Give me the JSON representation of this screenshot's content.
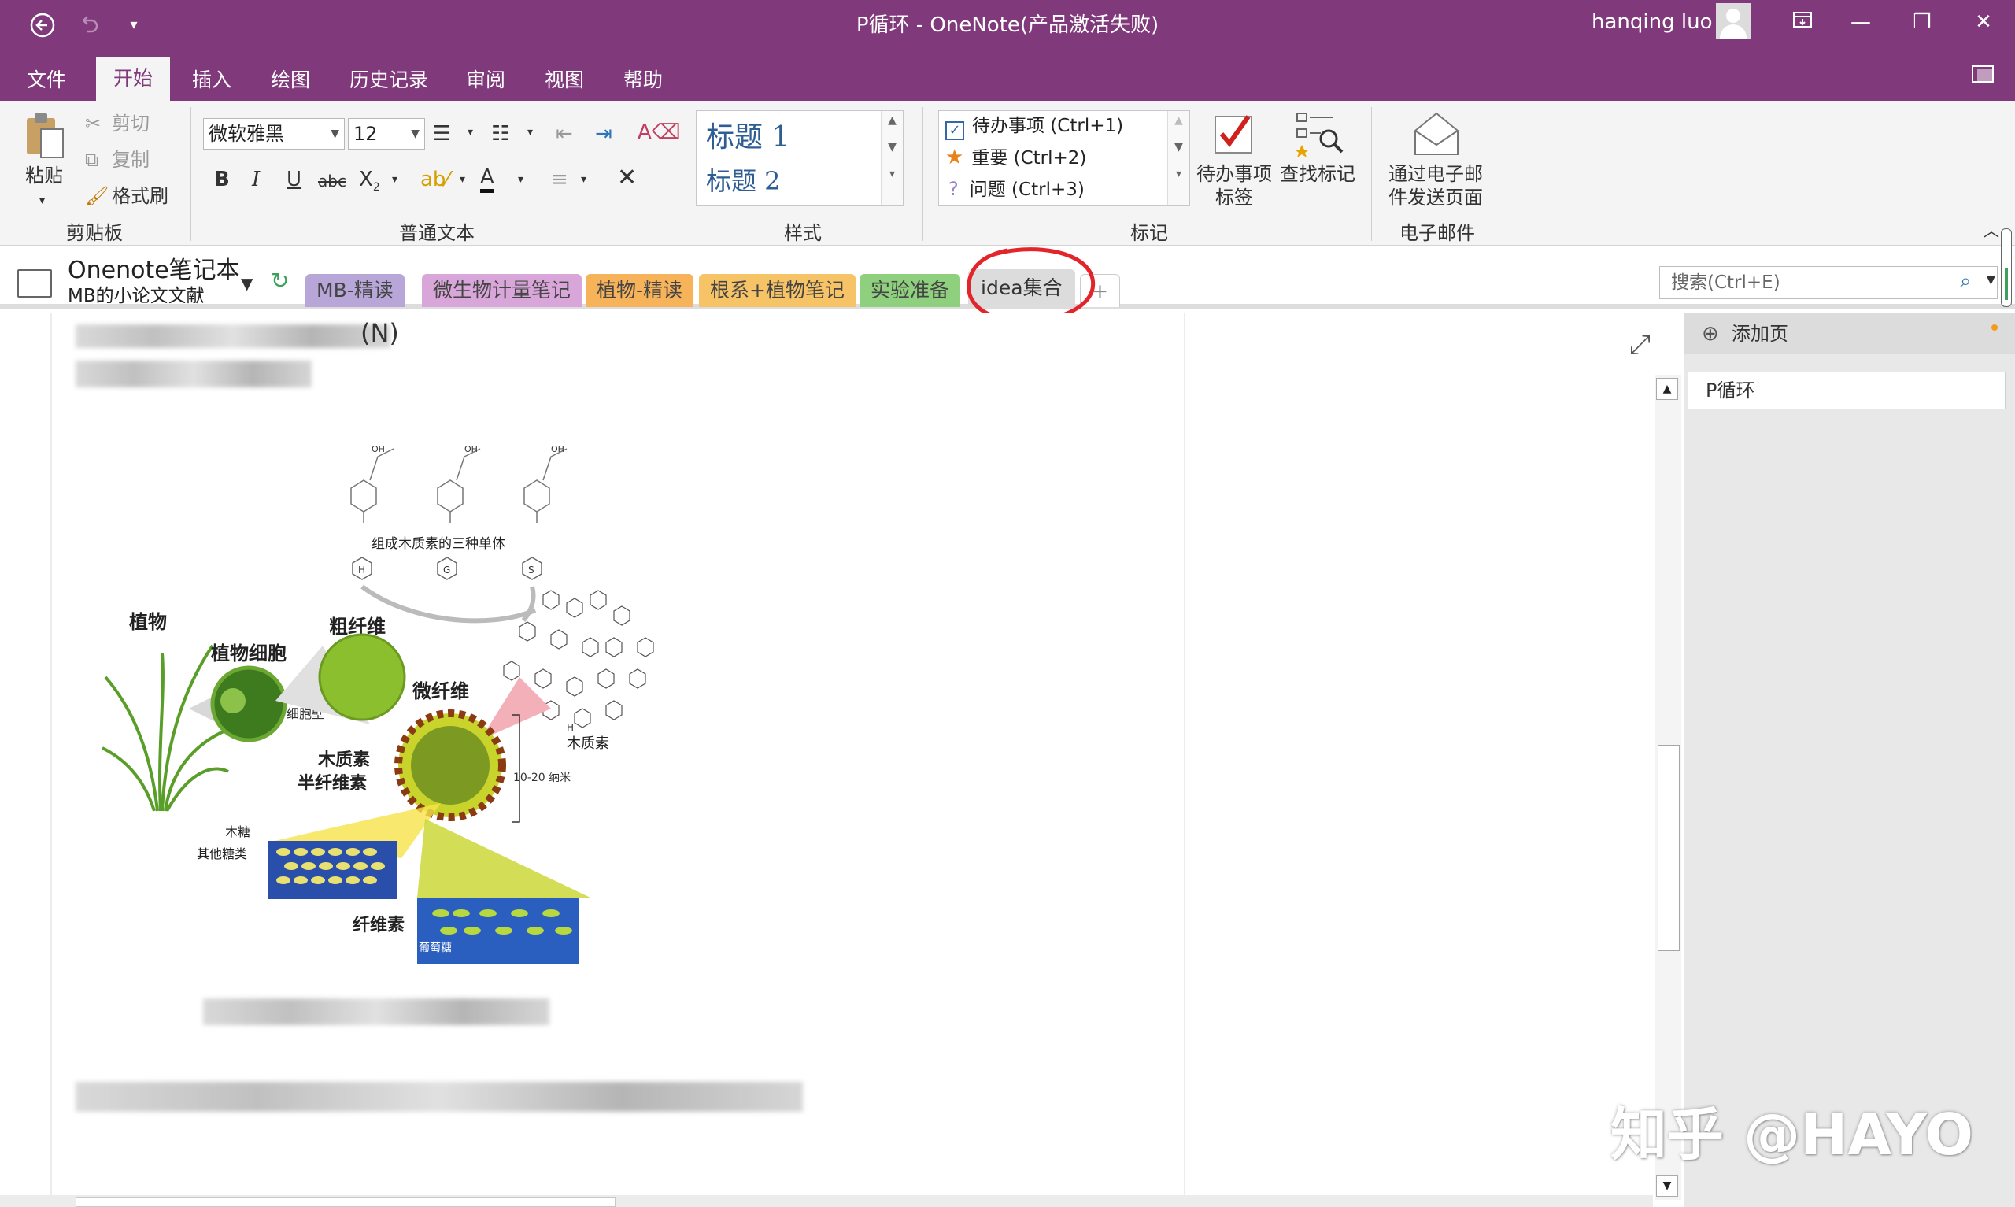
{
  "window": {
    "title": "P循环  -  OneNote(产品激活失败)",
    "username": "hanqing luo",
    "accent_color": "#80397b"
  },
  "ribbon_tabs": [
    "文件",
    "开始",
    "插入",
    "绘图",
    "历史记录",
    "审阅",
    "视图",
    "帮助"
  ],
  "clipboard": {
    "paste": "粘贴",
    "cut": "剪切",
    "copy": "复制",
    "format_painter": "格式刷",
    "group": "剪贴板"
  },
  "basic_text": {
    "font": "微软雅黑",
    "size": "12",
    "group": "普通文本"
  },
  "styles": {
    "heading1": "标题 1",
    "heading2": "标题 2",
    "group": "样式"
  },
  "tags": {
    "items": [
      "待办事项 (Ctrl+1)",
      "重要 (Ctrl+2)",
      "问题 (Ctrl+3)"
    ],
    "todo_tag": "待办事项\n标签",
    "todo_tag_line1": "待办事项",
    "todo_tag_line2": "标签",
    "find_tags": "查找标记",
    "group": "标记"
  },
  "email": {
    "line1": "通过电子邮",
    "line2": "件发送页面",
    "group": "电子邮件"
  },
  "notebook": {
    "name": "Onenote笔记本",
    "subtitle": "MB的小论文文献"
  },
  "sections": [
    {
      "label": "MB-精读",
      "color": "#b8a6d9"
    },
    {
      "label": "微生物计量笔记",
      "color": "#d9a6d9"
    },
    {
      "label": "植物-精读",
      "color": "#f7b35a"
    },
    {
      "label": "根系+植物笔记",
      "color": "#f6c366"
    },
    {
      "label": "实验准备",
      "color": "#8fd07f"
    },
    {
      "label": "idea集合",
      "color": "#dcdcdc"
    }
  ],
  "add_section": "+",
  "search_placeholder": "搜索(Ctrl+E)",
  "page_pane": {
    "add_page": "添加页",
    "pages": [
      "P循环"
    ]
  },
  "content": {
    "partial_line": "(N)",
    "diagram_labels": {
      "monomers": "组成木质素的三种单体",
      "plant": "植物",
      "plant_cell": "植物细胞",
      "cell_wall": "细胞壁",
      "coarse_fiber": "粗纤维",
      "microfiber": "微纤维",
      "lignin_small": "木质素",
      "lignin": "木质素",
      "hemicellulose": "半纤维素",
      "scale": "10-20 纳米",
      "xylose": "木糖",
      "other_sugars": "其他糖类",
      "cellulose": "纤维素",
      "glucose": "葡萄糖",
      "h": "H",
      "g": "G",
      "s": "S"
    }
  },
  "watermark": "知乎 @HAYO"
}
